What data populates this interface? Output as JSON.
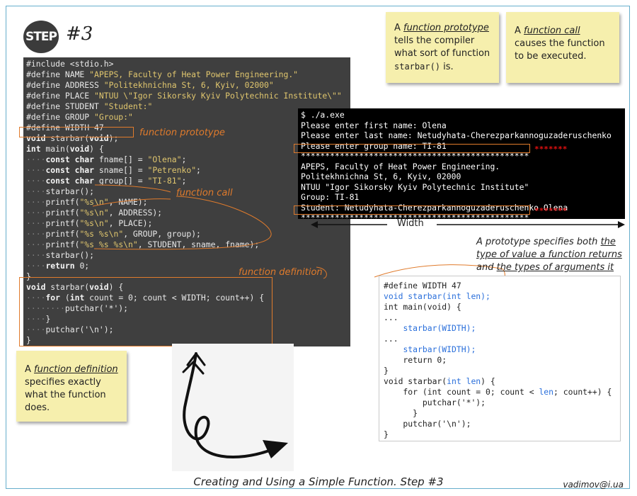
{
  "header": {
    "logo_text": "STEP",
    "step_title": "#3"
  },
  "code_main": {
    "lines": [
      "#include <stdio.h>",
      "#define NAME \"APEPS, Faculty of Heat Power Engineering.\"",
      "#define ADDRESS \"Politekhnichna St, 6, Kyiv, 02000\"",
      "#define PLACE \"NTUU \\\"Igor Sikorsky Kyiv Polytechnic Institute\\\"\"",
      "#define STUDENT \"Student:\"",
      "#define GROUP \"Group:\"",
      "#define WIDTH 47",
      "void starbar(void);",
      "int main(void) {",
      "    const char fname[] = \"Olena\";",
      "    const char sname[] = \"Petrenko\";",
      "    const char group[] = \"TI-81\";",
      "    starbar();",
      "    printf(\"%s\\n\", NAME);",
      "    printf(\"%s\\n\", ADDRESS);",
      "    printf(\"%s\\n\", PLACE);",
      "    printf(\"%s %s\\n\", GROUP, group);",
      "    printf(\"%s %s %s\\n\", STUDENT, sname, fname);",
      "    starbar();",
      "    return 0;",
      "}",
      "void starbar(void) {",
      "    for (int count = 0; count < WIDTH; count++) {",
      "        putchar('*');",
      "    }",
      "    putchar('\\n');",
      "}"
    ]
  },
  "labels": {
    "function_prototype": "function prototype",
    "function_call": "function call",
    "function_definition": "function definition",
    "width": "Width"
  },
  "terminal": {
    "lines": [
      "$ ./a.exe",
      "Please enter first name: Olena",
      "Please enter last name: Netudyhata-Cherezparkannoguzaderuschenko",
      "Please enter group name: TI-81",
      "***********************************************",
      "APEPS, Faculty of Heat Power Engineering.",
      "Politekhnichna St, 6, Kyiv, 02000",
      "NTUU \"Igor Sikorsky Kyiv Polytechnic Institute\"",
      "Group: TI-81",
      "Student: Netudyhata-Cherezparkannoguzaderuschenko Olena",
      "***********************************************"
    ],
    "red_stars_1": "*******",
    "red_stars_2": "*******"
  },
  "notes": {
    "prototype": {
      "prefix": "A ",
      "term": "function prototype",
      "text": " tells the compiler what sort of function ",
      "code": "starbar()",
      "suffix": " is."
    },
    "call": {
      "prefix": "A ",
      "term": "function call",
      "text": " causes the function to be executed."
    },
    "definition": {
      "prefix": "A ",
      "term": "function definition",
      "text": " specifies exactly what the function does."
    }
  },
  "prototype_info": {
    "part1": "A prototype specifies both ",
    "term1": "the type of value a function returns",
    "part2": " and ",
    "term2": "the types of arguments it expects."
  },
  "code_example": {
    "lines": [
      "#define WIDTH 47",
      "void starbar(int len);",
      "int main(void) {",
      "...",
      "    starbar(WIDTH);",
      "...",
      "    starbar(WIDTH);",
      "    return 0;",
      "}",
      "void starbar(int len) {",
      "    for (int count = 0; count < len; count++) {",
      "        putchar('*');",
      "      }",
      "    putchar('\\n');",
      "}"
    ]
  },
  "footer": {
    "caption": "Creating and Using a Simple Function. Step #3",
    "email": "vadimov@i.ua"
  },
  "colors": {
    "accent_orange": "#e07b2c",
    "note_yellow": "#f6efad",
    "code_bg": "#3f3f3f",
    "keyword_blue": "#2a6fdb",
    "star_red": "#e01010"
  }
}
